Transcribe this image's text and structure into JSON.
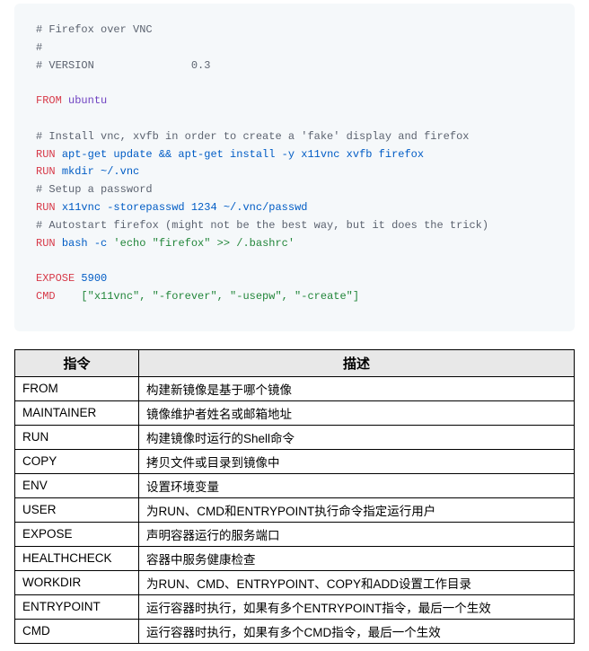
{
  "code": {
    "l1": "# Firefox over VNC",
    "l2": "#",
    "l3a": "# VERSION               ",
    "l3b": "0.3",
    "l4a": "FROM",
    "l4b": "ubuntu",
    "l5": "# Install vnc, xvfb in order to create a 'fake' display and firefox",
    "l6a": "RUN",
    "l6b": "apt-get update && apt-get install ",
    "l6c": "-y",
    "l6d": " x11vnc xvfb firefox",
    "l7a": "RUN",
    "l7b": "mkdir ~/.vnc",
    "l8": "# Setup a password",
    "l9a": "RUN",
    "l9b": "x11vnc -storepasswd ",
    "l9c": "1234",
    "l9d": " ~/.vnc/passwd",
    "l10": "# Autostart firefox (might not be the best way, but it does the trick)",
    "l11a": "RUN",
    "l11b": "bash ",
    "l11c": "-c",
    "l11d": " 'echo \"firefox\" >> /.bashrc'",
    "l12a": "EXPOSE",
    "l12b": "5900",
    "l13a": "CMD",
    "l13b": "[\"x11vnc\", \"-forever\", \"-usepw\", \"-create\"]"
  },
  "table": {
    "headers": {
      "col1": "指令",
      "col2": "描述"
    },
    "rows": [
      {
        "cmd": "FROM",
        "desc": "构建新镜像是基于哪个镜像"
      },
      {
        "cmd": "MAINTAINER",
        "desc": "镜像维护者姓名或邮箱地址"
      },
      {
        "cmd": "RUN",
        "desc": "构建镜像时运行的Shell命令"
      },
      {
        "cmd": "COPY",
        "desc": "拷贝文件或目录到镜像中"
      },
      {
        "cmd": "ENV",
        "desc": "设置环境变量"
      },
      {
        "cmd": "USER",
        "desc": "为RUN、CMD和ENTRYPOINT执行命令指定运行用户"
      },
      {
        "cmd": "EXPOSE",
        "desc": "声明容器运行的服务端口"
      },
      {
        "cmd": "HEALTHCHECK",
        "desc": "容器中服务健康检查"
      },
      {
        "cmd": "WORKDIR",
        "desc": "为RUN、CMD、ENTRYPOINT、COPY和ADD设置工作目录"
      },
      {
        "cmd": "ENTRYPOINT",
        "desc": "运行容器时执行，如果有多个ENTRYPOINT指令，最后一个生效"
      },
      {
        "cmd": "CMD",
        "desc": "运行容器时执行，如果有多个CMD指令，最后一个生效"
      }
    ]
  }
}
